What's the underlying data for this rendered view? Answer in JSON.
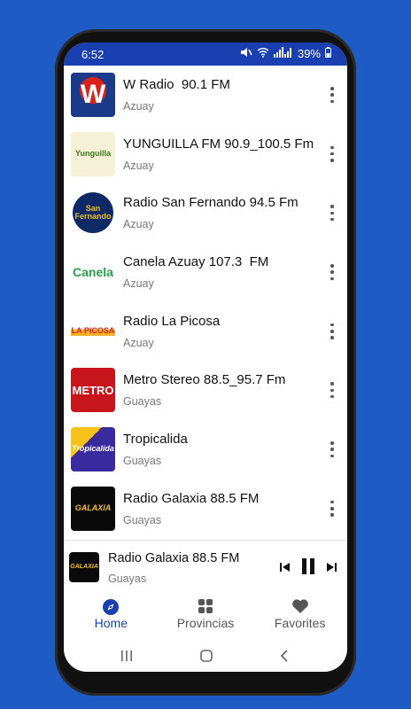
{
  "status": {
    "time": "6:52",
    "battery": "39%"
  },
  "stations": [
    {
      "name": "W Radio  90.1 FM",
      "province": "Azuay",
      "logo_text": "W",
      "logo_bg": "#1c3a8a",
      "logo_fg": "#ffffff"
    },
    {
      "name": "YUNGUILLA FM 90.9_100.5 Fm",
      "province": "Azuay",
      "logo_text": "Yunguilla",
      "logo_bg": "#f3f3e0",
      "logo_fg": "#3b7a1e"
    },
    {
      "name": "Radio San Fernando 94.5 Fm",
      "province": "Azuay",
      "logo_text": "San Fernando",
      "logo_bg": "#0e2a66",
      "logo_fg": "#f0c020"
    },
    {
      "name": "Canela Azuay 107.3  FM",
      "province": "Azuay",
      "logo_text": "Canela",
      "logo_bg": "#ffffff",
      "logo_fg": "#2aa04a"
    },
    {
      "name": "Radio La Picosa",
      "province": "Azuay",
      "logo_text": "LA PICOSA",
      "logo_bg": "#ffffff",
      "logo_fg": "#d8221a"
    },
    {
      "name": "Metro Stereo 88.5_95.7 Fm",
      "province": "Guayas",
      "logo_text": "METRO",
      "logo_bg": "#c8151b",
      "logo_fg": "#ffffff"
    },
    {
      "name": "Tropicalida",
      "province": "Guayas",
      "logo_text": "Tropicalida",
      "logo_bg": "#3a2aa0",
      "logo_fg": "#ffd23a"
    },
    {
      "name": "Radio Galaxia 88.5 FM",
      "province": "Guayas",
      "logo_text": "GALAXIA",
      "logo_bg": "#0a0a0a",
      "logo_fg": "#f2c21a"
    }
  ],
  "player": {
    "title": "Radio Galaxia 88.5 FM",
    "subtitle": "Guayas",
    "logo_text": "GALAXIA"
  },
  "nav": {
    "home": "Home",
    "provinces": "Provincias",
    "favorites": "Favorites"
  },
  "colors": {
    "accent": "#1a3fb0",
    "background": "#1f5bc4"
  }
}
